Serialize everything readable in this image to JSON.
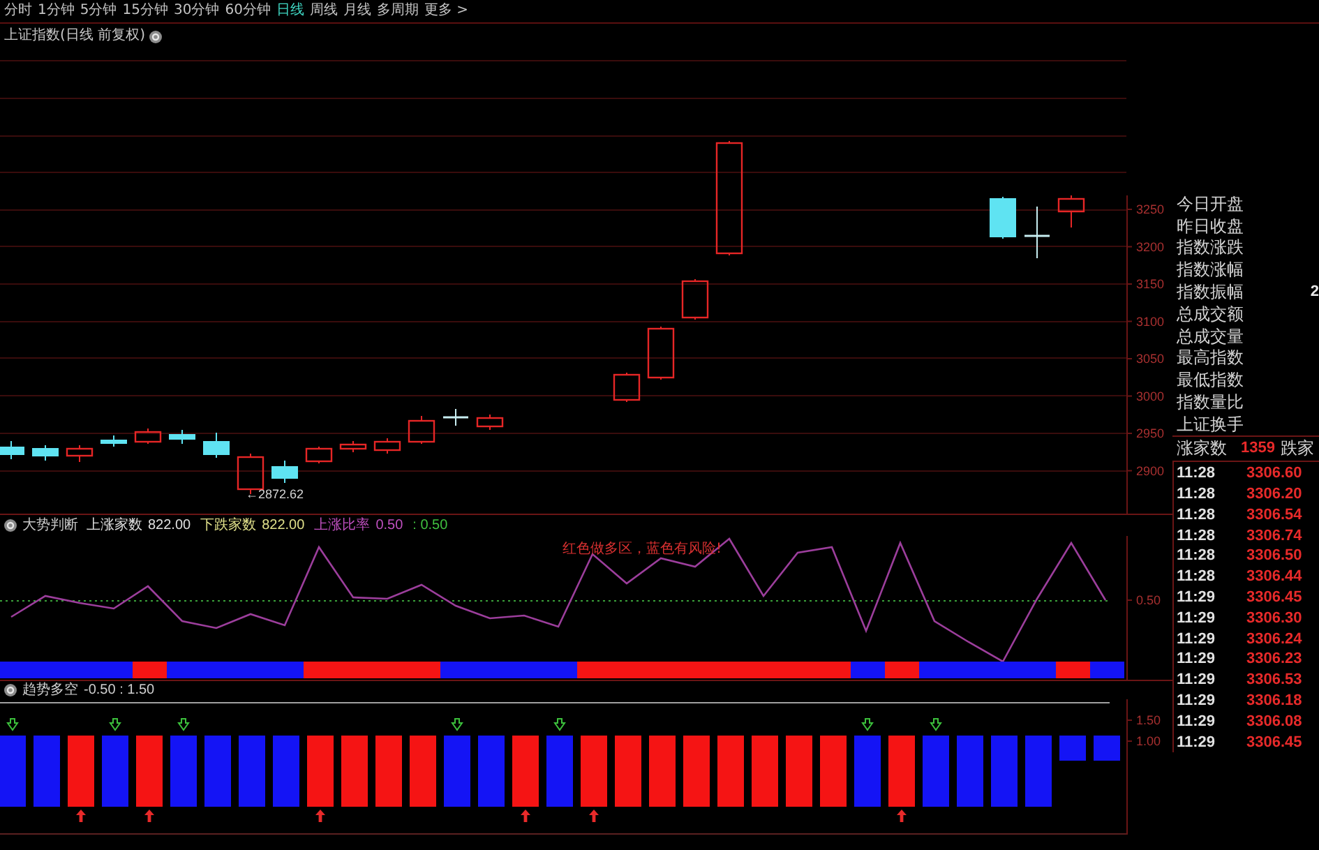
{
  "toolbar": {
    "tabs": [
      {
        "label": "分时",
        "selected": false
      },
      {
        "label": "1分钟",
        "selected": false
      },
      {
        "label": "5分钟",
        "selected": false
      },
      {
        "label": "15分钟",
        "selected": false
      },
      {
        "label": "30分钟",
        "selected": false
      },
      {
        "label": "60分钟",
        "selected": false
      },
      {
        "label": "日线",
        "selected": true
      },
      {
        "label": "周线",
        "selected": false
      },
      {
        "label": "月线",
        "selected": false
      },
      {
        "label": "多周期",
        "selected": false
      },
      {
        "label": "更多 >",
        "selected": false
      }
    ]
  },
  "title": "上证指数(日线 前复权)",
  "main_chart": {
    "price_ticks": [
      "3250",
      "3200",
      "3150",
      "3100",
      "3050",
      "3000",
      "2950",
      "2900"
    ],
    "low_label": "←2872.62",
    "candles": [
      {
        "kind": "fall"
      },
      {
        "kind": "fall"
      },
      {
        "kind": "rise"
      },
      {
        "kind": "fall"
      },
      {
        "kind": "rise"
      },
      {
        "kind": "fall"
      },
      {
        "kind": "fall"
      },
      {
        "kind": "rise"
      },
      {
        "kind": "fall"
      },
      {
        "kind": "rise"
      },
      {
        "kind": "rise"
      },
      {
        "kind": "rise"
      },
      {
        "kind": "rise"
      },
      {
        "kind": "doji"
      },
      {
        "kind": "rise"
      },
      {
        "kind": "rise"
      },
      {
        "kind": "rise"
      },
      {
        "kind": "rise"
      },
      {
        "kind": "rise"
      },
      {
        "kind": "fall"
      },
      {
        "kind": "doji"
      },
      {
        "kind": "rise"
      }
    ]
  },
  "indicator": {
    "name": "大势判断",
    "legend": [
      {
        "label": "上涨家数",
        "value": "822.00",
        "color": "#e0e0e0"
      },
      {
        "label": "下跌家数",
        "value": "822.00",
        "color": "#e0e08a"
      },
      {
        "label": "上涨比率",
        "value": "0.50",
        "color": "#c050c0"
      },
      {
        "value": ": 0.50",
        "color": "#40c040"
      }
    ],
    "note": "红色做多区，蓝色有风险!",
    "axis_tick": "0.50",
    "strip": [
      {
        "color": "#1414f5"
      },
      {
        "color": "#1414f5"
      },
      {
        "color": "#1414f5"
      },
      {
        "color": "#1414f5"
      },
      {
        "color": "#f51414"
      },
      {
        "color": "#1414f5"
      },
      {
        "color": "#1414f5"
      },
      {
        "color": "#1414f5"
      },
      {
        "color": "#1414f5"
      },
      {
        "color": "#f51414"
      },
      {
        "color": "#f51414"
      },
      {
        "color": "#f51414"
      },
      {
        "color": "#f51414"
      },
      {
        "color": "#1414f5"
      },
      {
        "color": "#1414f5"
      },
      {
        "color": "#1414f5"
      },
      {
        "color": "#1414f5"
      },
      {
        "color": "#f51414"
      },
      {
        "color": "#f51414"
      },
      {
        "color": "#f51414"
      },
      {
        "color": "#f51414"
      },
      {
        "color": "#f51414"
      },
      {
        "color": "#f51414"
      },
      {
        "color": "#f51414"
      },
      {
        "color": "#f51414"
      },
      {
        "color": "#1414f5"
      },
      {
        "color": "#f51414"
      },
      {
        "color": "#1414f5"
      },
      {
        "color": "#1414f5"
      },
      {
        "color": "#1414f5"
      },
      {
        "color": "#1414f5"
      },
      {
        "color": "#f51414"
      },
      {
        "color": "#1414f5"
      }
    ]
  },
  "trend_panel": {
    "name": "趋势多空",
    "params": "-0.50 : 1.50",
    "axis_ticks": [
      "1.50",
      "1.00"
    ],
    "bars": [
      {
        "color": "#1414f5",
        "kind": "full",
        "sell_mark": true,
        "buy_mark": false
      },
      {
        "color": "#1414f5",
        "kind": "full",
        "sell_mark": false,
        "buy_mark": false
      },
      {
        "color": "#f51414",
        "kind": "full",
        "sell_mark": false,
        "buy_mark": true
      },
      {
        "color": "#1414f5",
        "kind": "full",
        "sell_mark": true,
        "buy_mark": false
      },
      {
        "color": "#f51414",
        "kind": "full",
        "sell_mark": false,
        "buy_mark": true
      },
      {
        "color": "#1414f5",
        "kind": "full",
        "sell_mark": true,
        "buy_mark": false
      },
      {
        "color": "#1414f5",
        "kind": "full",
        "sell_mark": false,
        "buy_mark": false
      },
      {
        "color": "#1414f5",
        "kind": "full",
        "sell_mark": false,
        "buy_mark": false
      },
      {
        "color": "#1414f5",
        "kind": "full",
        "sell_mark": false,
        "buy_mark": false
      },
      {
        "color": "#f51414",
        "kind": "full",
        "sell_mark": false,
        "buy_mark": true
      },
      {
        "color": "#f51414",
        "kind": "full",
        "sell_mark": false,
        "buy_mark": false
      },
      {
        "color": "#f51414",
        "kind": "full",
        "sell_mark": false,
        "buy_mark": false
      },
      {
        "color": "#f51414",
        "kind": "full",
        "sell_mark": false,
        "buy_mark": false
      },
      {
        "color": "#1414f5",
        "kind": "full",
        "sell_mark": true,
        "buy_mark": false
      },
      {
        "color": "#1414f5",
        "kind": "full",
        "sell_mark": false,
        "buy_mark": false
      },
      {
        "color": "#f51414",
        "kind": "full",
        "sell_mark": false,
        "buy_mark": true
      },
      {
        "color": "#1414f5",
        "kind": "full",
        "sell_mark": true,
        "buy_mark": false
      },
      {
        "color": "#f51414",
        "kind": "full",
        "sell_mark": false,
        "buy_mark": true
      },
      {
        "color": "#f51414",
        "kind": "full",
        "sell_mark": false,
        "buy_mark": false
      },
      {
        "color": "#f51414",
        "kind": "full",
        "sell_mark": false,
        "buy_mark": false
      },
      {
        "color": "#f51414",
        "kind": "full",
        "sell_mark": false,
        "buy_mark": false
      },
      {
        "color": "#f51414",
        "kind": "full",
        "sell_mark": false,
        "buy_mark": false
      },
      {
        "color": "#f51414",
        "kind": "full",
        "sell_mark": false,
        "buy_mark": false
      },
      {
        "color": "#f51414",
        "kind": "full",
        "sell_mark": false,
        "buy_mark": false
      },
      {
        "color": "#f51414",
        "kind": "full",
        "sell_mark": false,
        "buy_mark": false
      },
      {
        "color": "#1414f5",
        "kind": "full",
        "sell_mark": true,
        "buy_mark": false
      },
      {
        "color": "#f51414",
        "kind": "full",
        "sell_mark": false,
        "buy_mark": true
      },
      {
        "color": "#1414f5",
        "kind": "full",
        "sell_mark": true,
        "buy_mark": false
      },
      {
        "color": "#1414f5",
        "kind": "full",
        "sell_mark": false,
        "buy_mark": false
      },
      {
        "color": "#1414f5",
        "kind": "full",
        "sell_mark": false,
        "buy_mark": false
      },
      {
        "color": "#1414f5",
        "kind": "full",
        "sell_mark": false,
        "buy_mark": false
      },
      {
        "color": "#1414f5",
        "kind": "short",
        "sell_mark": false,
        "buy_mark": false
      },
      {
        "color": "#1414f5",
        "kind": "short",
        "sell_mark": false,
        "buy_mark": false
      }
    ]
  },
  "quote_panel": {
    "fields": [
      {
        "label": "今日开盘"
      },
      {
        "label": "昨日收盘"
      },
      {
        "label": "指数涨跌"
      },
      {
        "label": "指数涨幅"
      },
      {
        "label": "指数振幅",
        "value": "2"
      },
      {
        "label": "总成交额"
      },
      {
        "label": "总成交量"
      },
      {
        "label": "最高指数"
      },
      {
        "label": "最低指数"
      },
      {
        "label": "指数量比"
      },
      {
        "label": "上证换手"
      }
    ],
    "breadth": {
      "up_label": "涨家数",
      "up_count": "1359",
      "down_label": "跌家"
    },
    "ticks": [
      {
        "time": "11:28",
        "price": "3306.60"
      },
      {
        "time": "11:28",
        "price": "3306.20"
      },
      {
        "time": "11:28",
        "price": "3306.54"
      },
      {
        "time": "11:28",
        "price": "3306.74"
      },
      {
        "time": "11:28",
        "price": "3306.50"
      },
      {
        "time": "11:28",
        "price": "3306.44"
      },
      {
        "time": "11:29",
        "price": "3306.45"
      },
      {
        "time": "11:29",
        "price": "3306.30"
      },
      {
        "time": "11:29",
        "price": "3306.24"
      },
      {
        "time": "11:29",
        "price": "3306.23"
      },
      {
        "time": "11:29",
        "price": "3306.53"
      },
      {
        "time": "11:29",
        "price": "3306.18"
      },
      {
        "time": "11:29",
        "price": "3306.08"
      },
      {
        "time": "11:29",
        "price": "3306.45"
      }
    ]
  }
}
